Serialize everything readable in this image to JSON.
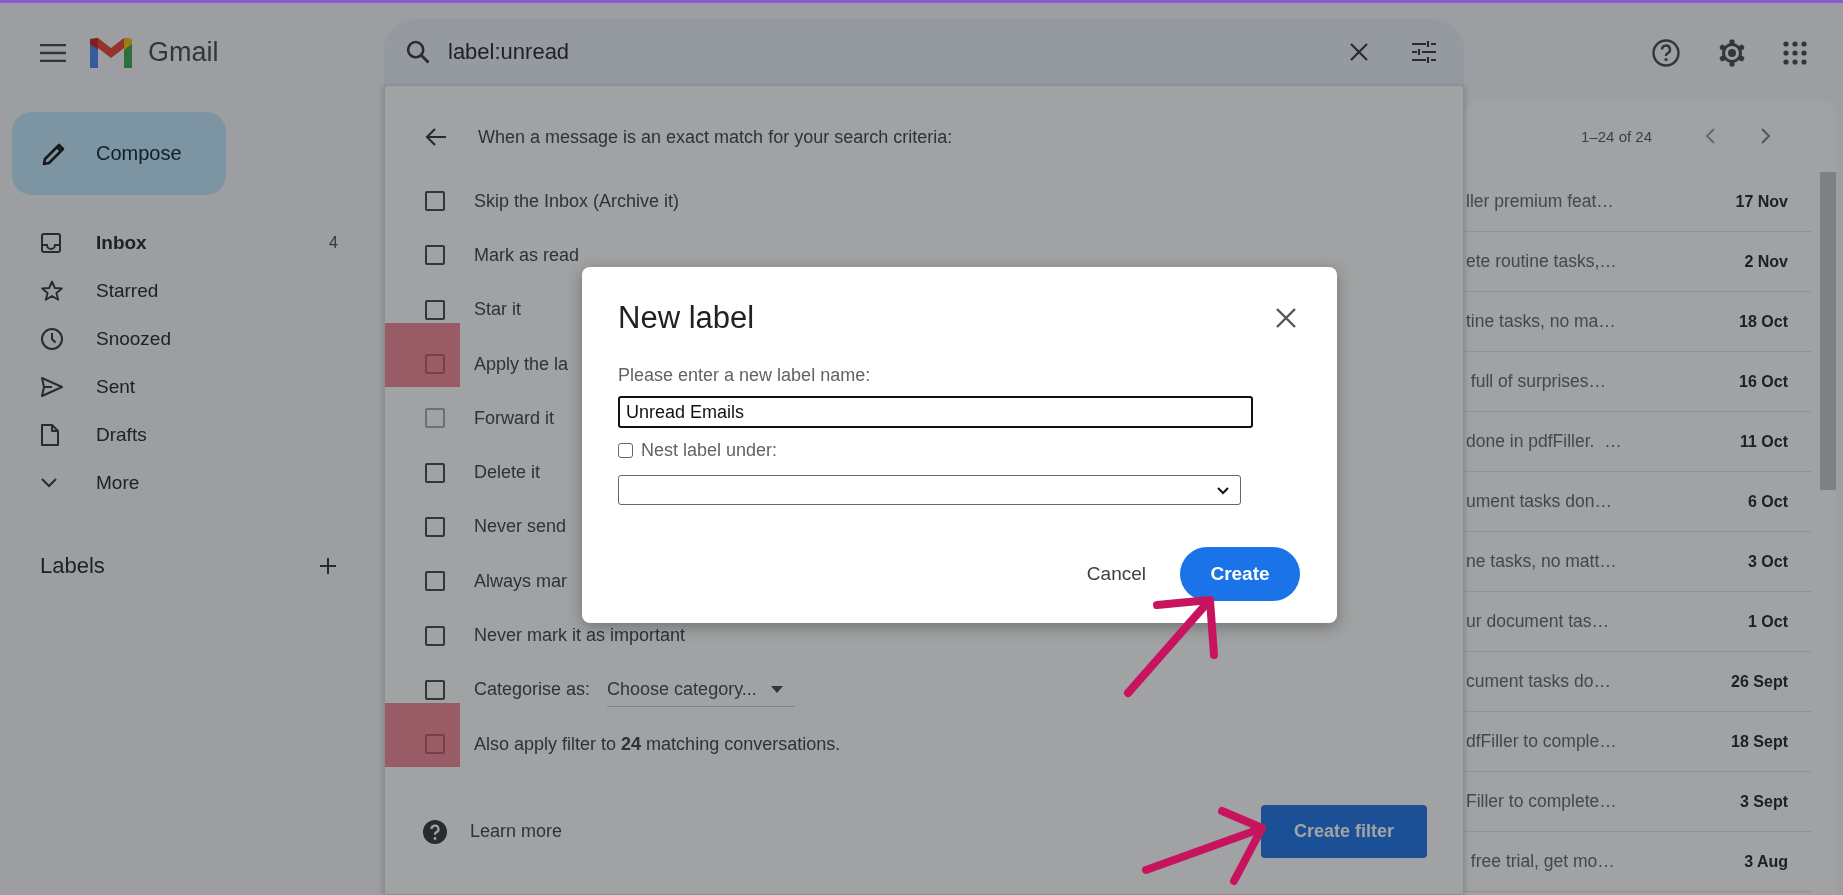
{
  "header": {
    "app_name": "Gmail",
    "search": {
      "value": "label:unread"
    }
  },
  "sidebar": {
    "compose": "Compose",
    "items": [
      {
        "label": "Inbox",
        "count": "4",
        "unread": true
      },
      {
        "label": "Starred",
        "unread": false
      },
      {
        "label": "Snoozed",
        "unread": false
      },
      {
        "label": "Sent",
        "unread": false
      },
      {
        "label": "Drafts",
        "unread": false
      },
      {
        "label": "More",
        "unread": false
      }
    ],
    "labels_heading": "Labels"
  },
  "filter": {
    "heading": "When a message is an exact match for your search criteria:",
    "options": [
      {
        "kind": "checkbox",
        "label": "Skip the Inbox (Archive it)",
        "checked": false,
        "disabled": false,
        "highlighted": false
      },
      {
        "kind": "checkbox",
        "label": "Mark as read",
        "checked": false,
        "disabled": false,
        "highlighted": false
      },
      {
        "kind": "checkbox",
        "label": "Star it",
        "checked": false,
        "disabled": false,
        "highlighted": false
      },
      {
        "kind": "checkbox",
        "label": "Apply the la",
        "checked": false,
        "disabled": false,
        "highlighted": true
      },
      {
        "kind": "checkbox",
        "label": "Forward it",
        "checked": false,
        "disabled": true,
        "highlighted": false
      },
      {
        "kind": "checkbox",
        "label": "Delete it",
        "checked": false,
        "disabled": false,
        "highlighted": false
      },
      {
        "kind": "checkbox",
        "label": "Never send",
        "checked": false,
        "disabled": false,
        "highlighted": false
      },
      {
        "kind": "checkbox",
        "label": "Always mar",
        "checked": false,
        "disabled": false,
        "highlighted": false
      },
      {
        "kind": "checkbox",
        "label": "Never mark it as important",
        "checked": false,
        "disabled": false,
        "highlighted": false
      },
      {
        "kind": "select",
        "label": "Categorise as:",
        "value": "Choose category...",
        "checked": false,
        "disabled": false,
        "highlighted": false
      },
      {
        "kind": "checkbox",
        "label": "Also apply filter to **24** matching conversations.",
        "checked": false,
        "disabled": false,
        "highlighted": true
      }
    ],
    "learn_more": "Learn more",
    "create_filter": "Create filter"
  },
  "list": {
    "range": "1–24 of 24",
    "rows": [
      {
        "snippet": "ller premium feat…",
        "date": "17 Nov"
      },
      {
        "snippet": "ete routine tasks,…",
        "date": "2 Nov"
      },
      {
        "snippet": "tine tasks, no ma…",
        "date": "18 Oct"
      },
      {
        "snippet": " full of surprises…",
        "date": "16 Oct"
      },
      {
        "snippet": "done in pdfFiller.  …",
        "date": "11 Oct"
      },
      {
        "snippet": "ument tasks don…",
        "date": "6 Oct"
      },
      {
        "snippet": "ne tasks, no matt…",
        "date": "3 Oct"
      },
      {
        "snippet": "ur document tas…",
        "date": "1 Oct"
      },
      {
        "snippet": "cument tasks do…",
        "date": "26 Sept"
      },
      {
        "snippet": "dfFiller to comple…",
        "date": "18 Sept"
      },
      {
        "snippet": "Filler to complete…",
        "date": "3 Sept"
      },
      {
        "snippet": " free trial, get mo…",
        "date": "3 Aug"
      }
    ]
  },
  "dialog": {
    "title": "New label",
    "name_label": "Please enter a new label name:",
    "name_value": "Unread Emails",
    "nest": {
      "label": "Nest label under:",
      "checked": false
    },
    "cancel": "Cancel",
    "create": "Create"
  },
  "annotations": [
    {
      "kind": "arrow"
    },
    {
      "kind": "arrow"
    }
  ]
}
